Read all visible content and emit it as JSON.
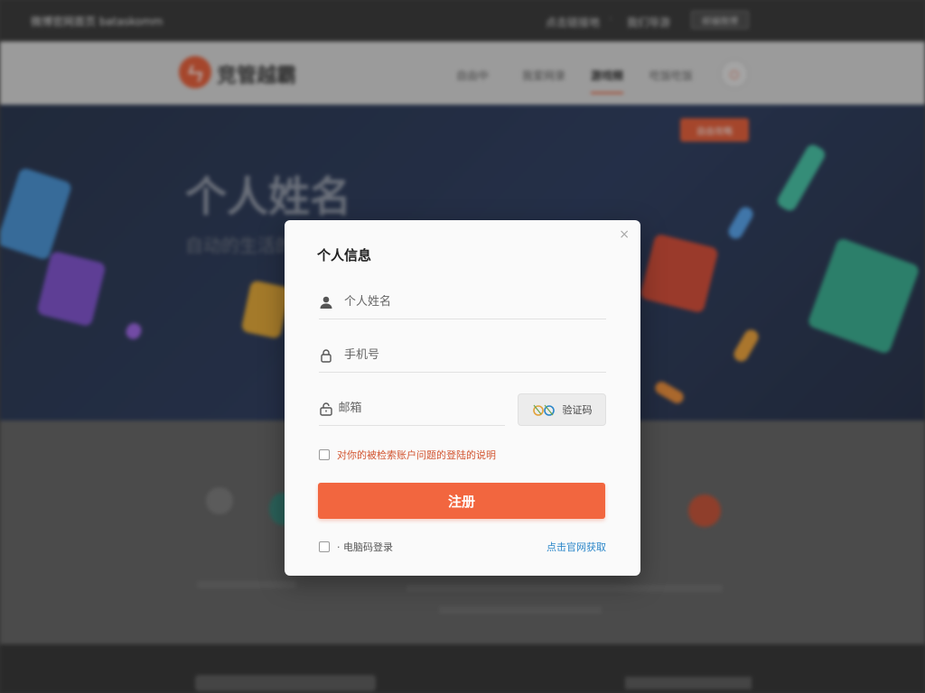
{
  "topbar": {
    "site_title": "微博官网首页 bataskomm",
    "link1": "点击链接地",
    "separator": "·",
    "link2": "我们导游",
    "button": "邮编微博"
  },
  "nav": {
    "logo_mark": "ㄣ",
    "logo_text": "竞管越霸",
    "items": [
      "自由中",
      "我爱网录",
      "游戏频",
      "吃饭吃饭"
    ],
    "active_index": 2
  },
  "hero": {
    "title": "个人姓名",
    "subtitle": "自动的生活的",
    "button": "自由攻略"
  },
  "modal": {
    "close": "×",
    "title": "个人信息",
    "name_placeholder": "个人姓名",
    "phone_placeholder": "手机号",
    "email_placeholder": "邮箱",
    "captcha_label": "验证码",
    "agreement": "对你的被检索账户问题的登陆的说明",
    "submit": "注册",
    "remember": "· 电脑码登录",
    "official_link": "点击官网获取"
  },
  "colors": {
    "accent": "#f2663f",
    "link": "#2a86c9",
    "hero_bg": "#223357"
  }
}
